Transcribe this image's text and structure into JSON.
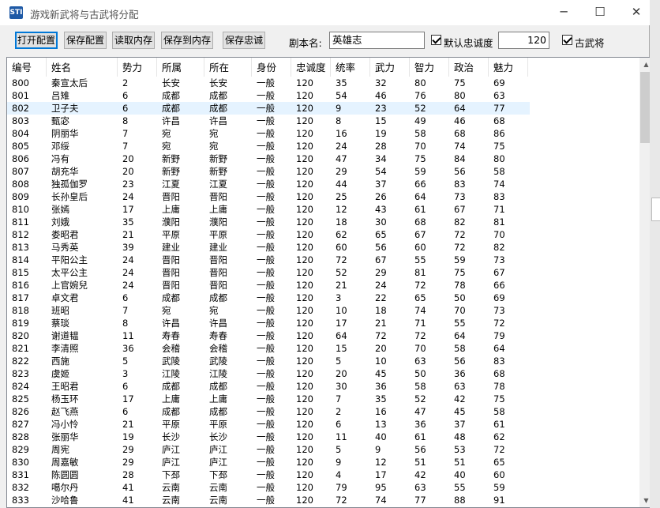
{
  "window": {
    "title": "游戏新武将与古武将分配",
    "icon_text": "STI",
    "minimize_icon": "─",
    "maximize_icon": "☐",
    "close_icon": "✕"
  },
  "toolbar": {
    "open_config": "打开配置",
    "save_config": "保存配置",
    "read_memory": "读取内存",
    "save_to_memory": "保存到内存",
    "save_loyalty": "保存忠诚",
    "script_label": "剧本名:",
    "script_name": "英雄志",
    "default_loyalty_label": "默认忠诚度",
    "default_loyalty_value": "120",
    "ancient_general_label": "古武将"
  },
  "table": {
    "columns": [
      "编号",
      "姓名",
      "势力",
      "所属",
      "所在",
      "身份",
      "忠诚度",
      "统率",
      "武力",
      "智力",
      "政治",
      "魅力"
    ],
    "rows": [
      [
        "800",
        "秦宣太后",
        "2",
        "长安",
        "长安",
        "一般",
        "120",
        "35",
        "32",
        "80",
        "75",
        "69"
      ],
      [
        "801",
        "吕雉",
        "6",
        "成都",
        "成都",
        "一般",
        "120",
        "54",
        "46",
        "76",
        "80",
        "63"
      ],
      [
        "802",
        "卫子夫",
        "6",
        "成都",
        "成都",
        "一般",
        "120",
        "9",
        "23",
        "52",
        "64",
        "77"
      ],
      [
        "803",
        "甄宓",
        "8",
        "许昌",
        "许昌",
        "一般",
        "120",
        "8",
        "15",
        "49",
        "46",
        "68"
      ],
      [
        "804",
        "阴丽华",
        "7",
        "宛",
        "宛",
        "一般",
        "120",
        "16",
        "19",
        "58",
        "68",
        "86"
      ],
      [
        "805",
        "邓绥",
        "7",
        "宛",
        "宛",
        "一般",
        "120",
        "24",
        "28",
        "70",
        "74",
        "75"
      ],
      [
        "806",
        "冯有",
        "20",
        "新野",
        "新野",
        "一般",
        "120",
        "47",
        "34",
        "75",
        "84",
        "80"
      ],
      [
        "807",
        "胡充华",
        "20",
        "新野",
        "新野",
        "一般",
        "120",
        "29",
        "54",
        "59",
        "56",
        "58"
      ],
      [
        "808",
        "独孤伽罗",
        "23",
        "江夏",
        "江夏",
        "一般",
        "120",
        "44",
        "37",
        "66",
        "83",
        "74"
      ],
      [
        "809",
        "长孙皇后",
        "24",
        "晋阳",
        "晋阳",
        "一般",
        "120",
        "25",
        "26",
        "64",
        "73",
        "83"
      ],
      [
        "810",
        "张嫣",
        "17",
        "上庸",
        "上庸",
        "一般",
        "120",
        "12",
        "43",
        "61",
        "67",
        "71"
      ],
      [
        "811",
        "刘娥",
        "35",
        "濮阳",
        "濮阳",
        "一般",
        "120",
        "18",
        "30",
        "68",
        "82",
        "81"
      ],
      [
        "812",
        "娄昭君",
        "21",
        "平原",
        "平原",
        "一般",
        "120",
        "62",
        "65",
        "67",
        "72",
        "70"
      ],
      [
        "813",
        "马秀英",
        "39",
        "建业",
        "建业",
        "一般",
        "120",
        "60",
        "56",
        "60",
        "72",
        "82"
      ],
      [
        "814",
        "平阳公主",
        "24",
        "晋阳",
        "晋阳",
        "一般",
        "120",
        "72",
        "67",
        "55",
        "59",
        "73"
      ],
      [
        "815",
        "太平公主",
        "24",
        "晋阳",
        "晋阳",
        "一般",
        "120",
        "52",
        "29",
        "81",
        "75",
        "67"
      ],
      [
        "816",
        "上官婉兒",
        "24",
        "晋阳",
        "晋阳",
        "一般",
        "120",
        "21",
        "24",
        "72",
        "78",
        "66"
      ],
      [
        "817",
        "卓文君",
        "6",
        "成都",
        "成都",
        "一般",
        "120",
        "3",
        "22",
        "65",
        "50",
        "69"
      ],
      [
        "818",
        "班昭",
        "7",
        "宛",
        "宛",
        "一般",
        "120",
        "10",
        "18",
        "74",
        "70",
        "73"
      ],
      [
        "819",
        "蔡琰",
        "8",
        "许昌",
        "许昌",
        "一般",
        "120",
        "17",
        "21",
        "71",
        "55",
        "72"
      ],
      [
        "820",
        "谢道韫",
        "11",
        "寿春",
        "寿春",
        "一般",
        "120",
        "64",
        "72",
        "72",
        "64",
        "79"
      ],
      [
        "821",
        "李清照",
        "36",
        "会稽",
        "会稽",
        "一般",
        "120",
        "15",
        "20",
        "70",
        "58",
        "64"
      ],
      [
        "822",
        "西施",
        "5",
        "武陵",
        "武陵",
        "一般",
        "120",
        "5",
        "10",
        "63",
        "56",
        "83"
      ],
      [
        "823",
        "虞姬",
        "3",
        "江陵",
        "江陵",
        "一般",
        "120",
        "20",
        "45",
        "50",
        "36",
        "68"
      ],
      [
        "824",
        "王昭君",
        "6",
        "成都",
        "成都",
        "一般",
        "120",
        "30",
        "36",
        "58",
        "63",
        "78"
      ],
      [
        "825",
        "杨玉环",
        "17",
        "上庸",
        "上庸",
        "一般",
        "120",
        "7",
        "35",
        "52",
        "42",
        "75"
      ],
      [
        "826",
        "赵飞燕",
        "6",
        "成都",
        "成都",
        "一般",
        "120",
        "2",
        "16",
        "47",
        "45",
        "58"
      ],
      [
        "827",
        "冯小怜",
        "21",
        "平原",
        "平原",
        "一般",
        "120",
        "6",
        "13",
        "36",
        "37",
        "61"
      ],
      [
        "828",
        "张丽华",
        "19",
        "长沙",
        "长沙",
        "一般",
        "120",
        "11",
        "40",
        "61",
        "48",
        "62"
      ],
      [
        "829",
        "周宪",
        "29",
        "庐江",
        "庐江",
        "一般",
        "120",
        "5",
        "9",
        "56",
        "53",
        "72"
      ],
      [
        "830",
        "周嘉敏",
        "29",
        "庐江",
        "庐江",
        "一般",
        "120",
        "9",
        "12",
        "51",
        "51",
        "65"
      ],
      [
        "831",
        "陈圆圆",
        "28",
        "下邳",
        "下邳",
        "一般",
        "120",
        "4",
        "17",
        "42",
        "40",
        "60"
      ],
      [
        "832",
        "噶尔丹",
        "41",
        "云南",
        "云南",
        "一般",
        "120",
        "79",
        "95",
        "63",
        "55",
        "59"
      ],
      [
        "833",
        "沙哈鲁",
        "41",
        "云南",
        "云南",
        "一般",
        "120",
        "72",
        "74",
        "77",
        "88",
        "91"
      ]
    ],
    "selected_row": 2
  },
  "scrollbar": {
    "up_icon": "▲",
    "down_icon": "▼"
  }
}
